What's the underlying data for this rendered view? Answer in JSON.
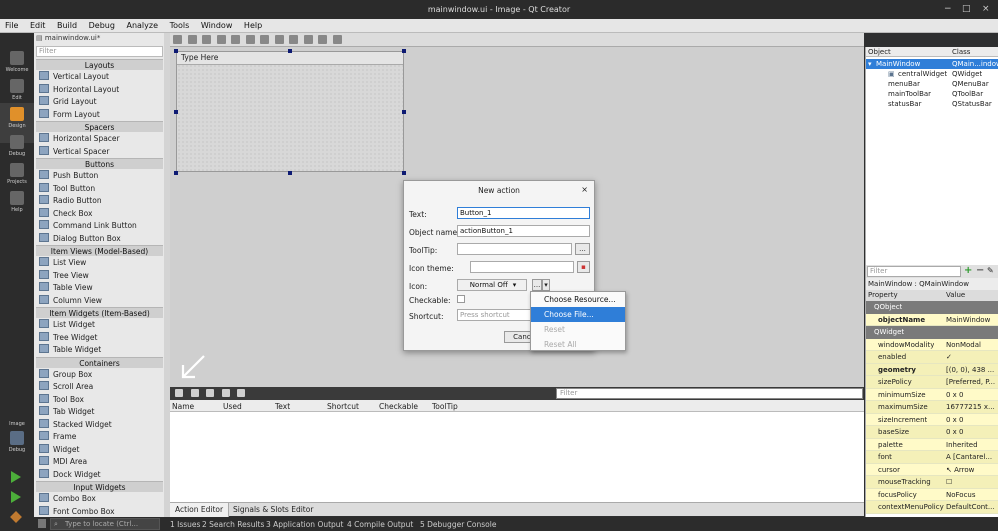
{
  "window": {
    "title": "mainwindow.ui - Image - Qt Creator",
    "controls": [
      "−",
      "□",
      "×"
    ]
  },
  "menubar": [
    "File",
    "Edit",
    "Build",
    "Debug",
    "Analyze",
    "Tools",
    "Window",
    "Help"
  ],
  "modes": [
    {
      "label": "Welcome",
      "icon": "grid-icon"
    },
    {
      "label": "Edit",
      "icon": "document-icon"
    },
    {
      "label": "Design",
      "icon": "pencil-icon"
    },
    {
      "label": "Debug",
      "icon": "bug-icon"
    },
    {
      "label": "Projects",
      "icon": "wrench-icon"
    },
    {
      "label": "Help",
      "icon": "help-icon"
    }
  ],
  "kit": {
    "label": "Image",
    "mode": "Debug"
  },
  "editor_tab": "mainwindow.ui*",
  "widgetbox": {
    "filter_placeholder": "Filter",
    "sections": [
      {
        "title": "Layouts",
        "items": [
          "Vertical Layout",
          "Horizontal Layout",
          "Grid Layout",
          "Form Layout"
        ]
      },
      {
        "title": "Spacers",
        "items": [
          "Horizontal Spacer",
          "Vertical Spacer"
        ]
      },
      {
        "title": "Buttons",
        "items": [
          "Push Button",
          "Tool Button",
          "Radio Button",
          "Check Box",
          "Command Link Button",
          "Dialog Button Box"
        ]
      },
      {
        "title": "Item Views (Model-Based)",
        "items": [
          "List View",
          "Tree View",
          "Table View",
          "Column View"
        ]
      },
      {
        "title": "Item Widgets (Item-Based)",
        "items": [
          "List Widget",
          "Tree Widget",
          "Table Widget"
        ]
      },
      {
        "title": "Containers",
        "items": [
          "Group Box",
          "Scroll Area",
          "Tool Box",
          "Tab Widget",
          "Stacked Widget",
          "Frame",
          "Widget",
          "MDI Area",
          "Dock Widget"
        ]
      },
      {
        "title": "Input Widgets",
        "items": [
          "Combo Box",
          "Font Combo Box"
        ]
      }
    ]
  },
  "form": {
    "menu_placeholder": "Type Here"
  },
  "dialog": {
    "title": "New action",
    "close": "×",
    "text_label": "Text:",
    "text_value": "Button_1",
    "objname_label": "Object name:",
    "objname_value": "actionButton_1",
    "tooltip_label": "ToolTip:",
    "tooltip_value": "",
    "icontheme_label": "Icon theme:",
    "icontheme_value": "",
    "icon_label": "Icon:",
    "icon_mode": "Normal Off",
    "checkable_label": "Checkable:",
    "shortcut_label": "Shortcut:",
    "shortcut_placeholder": "Press shortcut",
    "cancel_label": "Cancel",
    "browse_label": "...",
    "arrow_label": "▾"
  },
  "context_menu": [
    {
      "label": "Choose Resource...",
      "state": "normal"
    },
    {
      "label": "Choose File...",
      "state": "selected"
    },
    {
      "label": "Reset",
      "state": "disabled"
    },
    {
      "label": "Reset All",
      "state": "disabled"
    }
  ],
  "action_editor": {
    "filter_placeholder": "Filter",
    "columns": [
      "Name",
      "Used",
      "Text",
      "Shortcut",
      "Checkable",
      "ToolTip"
    ],
    "tabs": [
      "Action Editor",
      "Signals & Slots Editor"
    ]
  },
  "object_inspector": {
    "columns": [
      "Object",
      "Class"
    ],
    "rows": [
      {
        "object": "MainWindow",
        "class": "QMain...indow",
        "selected": true
      },
      {
        "object": "centralWidget",
        "class": "QWidget",
        "selected": false
      },
      {
        "object": "menuBar",
        "class": "QMenuBar",
        "selected": false
      },
      {
        "object": "mainToolBar",
        "class": "QToolBar",
        "selected": false
      },
      {
        "object": "statusBar",
        "class": "QStatusBar",
        "selected": false
      }
    ]
  },
  "property_editor": {
    "filter_placeholder": "Filter",
    "title": "MainWindow : QMainWindow",
    "columns": [
      "Property",
      "Value"
    ],
    "rows": [
      {
        "name": "QObject",
        "value": "",
        "type": "group"
      },
      {
        "name": "objectName",
        "value": "MainWindow",
        "type": "bold"
      },
      {
        "name": "QWidget",
        "value": "",
        "type": "group"
      },
      {
        "name": "windowModality",
        "value": "NonModal",
        "type": "y"
      },
      {
        "name": "enabled",
        "value": "✓",
        "type": "y2"
      },
      {
        "name": "geometry",
        "value": "[(0, 0), 438 ...",
        "type": "boldy"
      },
      {
        "name": "sizePolicy",
        "value": "[Preferred, P...",
        "type": "y2"
      },
      {
        "name": "minimumSize",
        "value": "0 x 0",
        "type": "y"
      },
      {
        "name": "maximumSize",
        "value": "16777215 x...",
        "type": "y2"
      },
      {
        "name": "sizeIncrement",
        "value": "0 x 0",
        "type": "y"
      },
      {
        "name": "baseSize",
        "value": "0 x 0",
        "type": "y2"
      },
      {
        "name": "palette",
        "value": "Inherited",
        "type": "y"
      },
      {
        "name": "font",
        "value": "A  [Cantarel...",
        "type": "y2"
      },
      {
        "name": "cursor",
        "value": "↖ Arrow",
        "type": "y"
      },
      {
        "name": "mouseTracking",
        "value": "☐",
        "type": "y2"
      },
      {
        "name": "focusPolicy",
        "value": "NoFocus",
        "type": "y"
      },
      {
        "name": "contextMenuPolicy",
        "value": "DefaultCont...",
        "type": "y2"
      }
    ]
  },
  "statusbar": {
    "locator_placeholder": "Type to locate (Ctrl...",
    "panes": [
      "1 Issues",
      "2 Search Results",
      "3 Application Output",
      "4 Compile Output",
      "5 Debugger Console"
    ]
  }
}
